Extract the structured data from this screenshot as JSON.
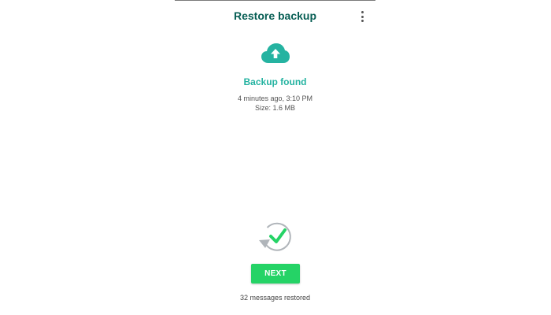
{
  "app_bar": {
    "title": "Restore backup",
    "menu_icon": "more-vert-icon"
  },
  "backup": {
    "icon": "cloud-upload-icon",
    "status": "Backup found",
    "time": "4 minutes ago, 3:10 PM",
    "size": "Size: 1.6 MB"
  },
  "restore": {
    "icon": "restore-check-icon",
    "next_label": "NEXT",
    "message": "32 messages restored"
  },
  "colors": {
    "title": "#075e54",
    "accent": "#25b3a1",
    "button": "#25d366",
    "check": "#25d366"
  }
}
